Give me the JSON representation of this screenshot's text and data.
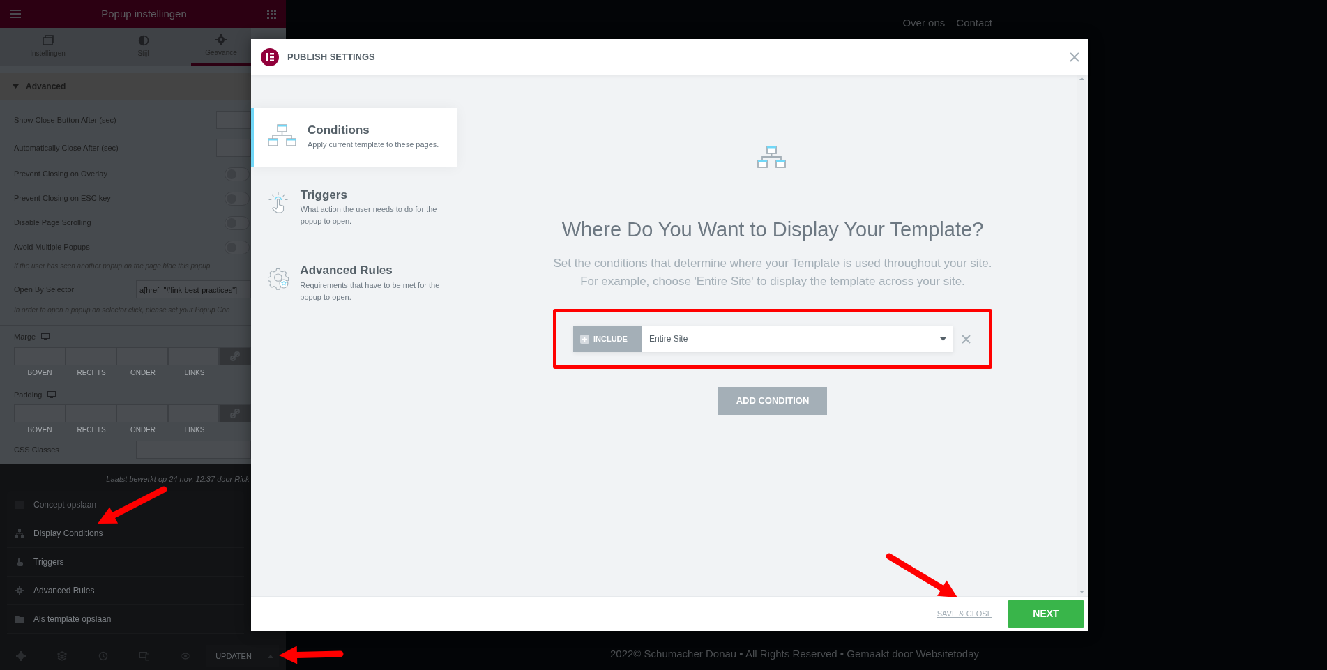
{
  "editor_panel": {
    "title": "Popup instellingen",
    "tabs": [
      {
        "kind": "content",
        "label": "Instellingen",
        "selected": false
      },
      {
        "kind": "style",
        "label": "Stijl",
        "selected": false
      },
      {
        "kind": "advanced",
        "label": "Geavance",
        "selected": true
      }
    ],
    "section": {
      "title": "Advanced",
      "expanded": true
    },
    "fields": [
      {
        "kind": "number",
        "label": "Show Close Button After (sec)"
      },
      {
        "kind": "number",
        "label": "Automatically Close After (sec)"
      },
      {
        "kind": "switch",
        "label": "Prevent Closing on Overlay",
        "on": false
      },
      {
        "kind": "switch",
        "label": "Prevent Closing on ESC key",
        "on": false
      },
      {
        "kind": "switch",
        "label": "Disable Page Scrolling",
        "on": false
      },
      {
        "kind": "switch",
        "label": "Avoid Multiple Popups",
        "on": false
      },
      {
        "kind": "note",
        "label": "If the user has seen another popup on the page hide this popup"
      },
      {
        "kind": "text",
        "label": "Open By Selector",
        "value": "a[href=\"#link-best-practices\"]"
      },
      {
        "kind": "note",
        "label": "In order to open a popup on selector click, please set your Popup Con"
      }
    ],
    "spacing": [
      {
        "label": "Marge",
        "linked": true,
        "sides": [
          "BOVEN",
          "RECHTS",
          "ONDER",
          "LINKS"
        ]
      },
      {
        "label": "Padding",
        "linked": true,
        "sides": [
          "BOVEN",
          "RECHTS",
          "ONDER",
          "LINKS"
        ]
      }
    ],
    "css_classes": {
      "label": "CSS Classes"
    }
  },
  "save_menu": {
    "last_edited": "Laatst bewerkt op 24 nov, 12:37 door Rick",
    "items": [
      {
        "kind": "save",
        "label": "Concept opslaan",
        "disabled": true
      },
      {
        "kind": "conditions",
        "label": "Display Conditions",
        "disabled": false
      },
      {
        "kind": "triggers",
        "label": "Triggers",
        "disabled": false
      },
      {
        "kind": "rules",
        "label": "Advanced Rules",
        "disabled": false
      },
      {
        "kind": "template",
        "label": "Als template opslaan",
        "disabled": false
      }
    ]
  },
  "bottom_bar": {
    "update_button": "UPDATEN"
  },
  "site": {
    "nav": [
      "Over ons",
      "Contact"
    ],
    "footer": "2022© Schumacher Donau • All Rights Reserved • Gemaakt door Websitetoday"
  },
  "modal": {
    "title": "PUBLISH SETTINGS",
    "tabs": [
      {
        "kind": "conditions",
        "title": "Conditions",
        "description": "Apply current template to these pages.",
        "selected": true
      },
      {
        "kind": "triggers",
        "title": "Triggers",
        "description": "What action the user needs to do for the popup to open.",
        "selected": false
      },
      {
        "kind": "rules",
        "title": "Advanced Rules",
        "description": "Requirements that have to be met for the popup to open.",
        "selected": false
      }
    ],
    "heading": "Where Do You Want to Display Your Template?",
    "description": [
      "Set the conditions that determine where your Template is used throughout your site.",
      "For example, choose 'Entire Site' to display the template across your site."
    ],
    "conditions": [
      {
        "type": "INCLUDE",
        "value": "Entire Site"
      }
    ],
    "add_button": "ADD CONDITION",
    "save_link": "SAVE & CLOSE",
    "next_button": "NEXT"
  }
}
